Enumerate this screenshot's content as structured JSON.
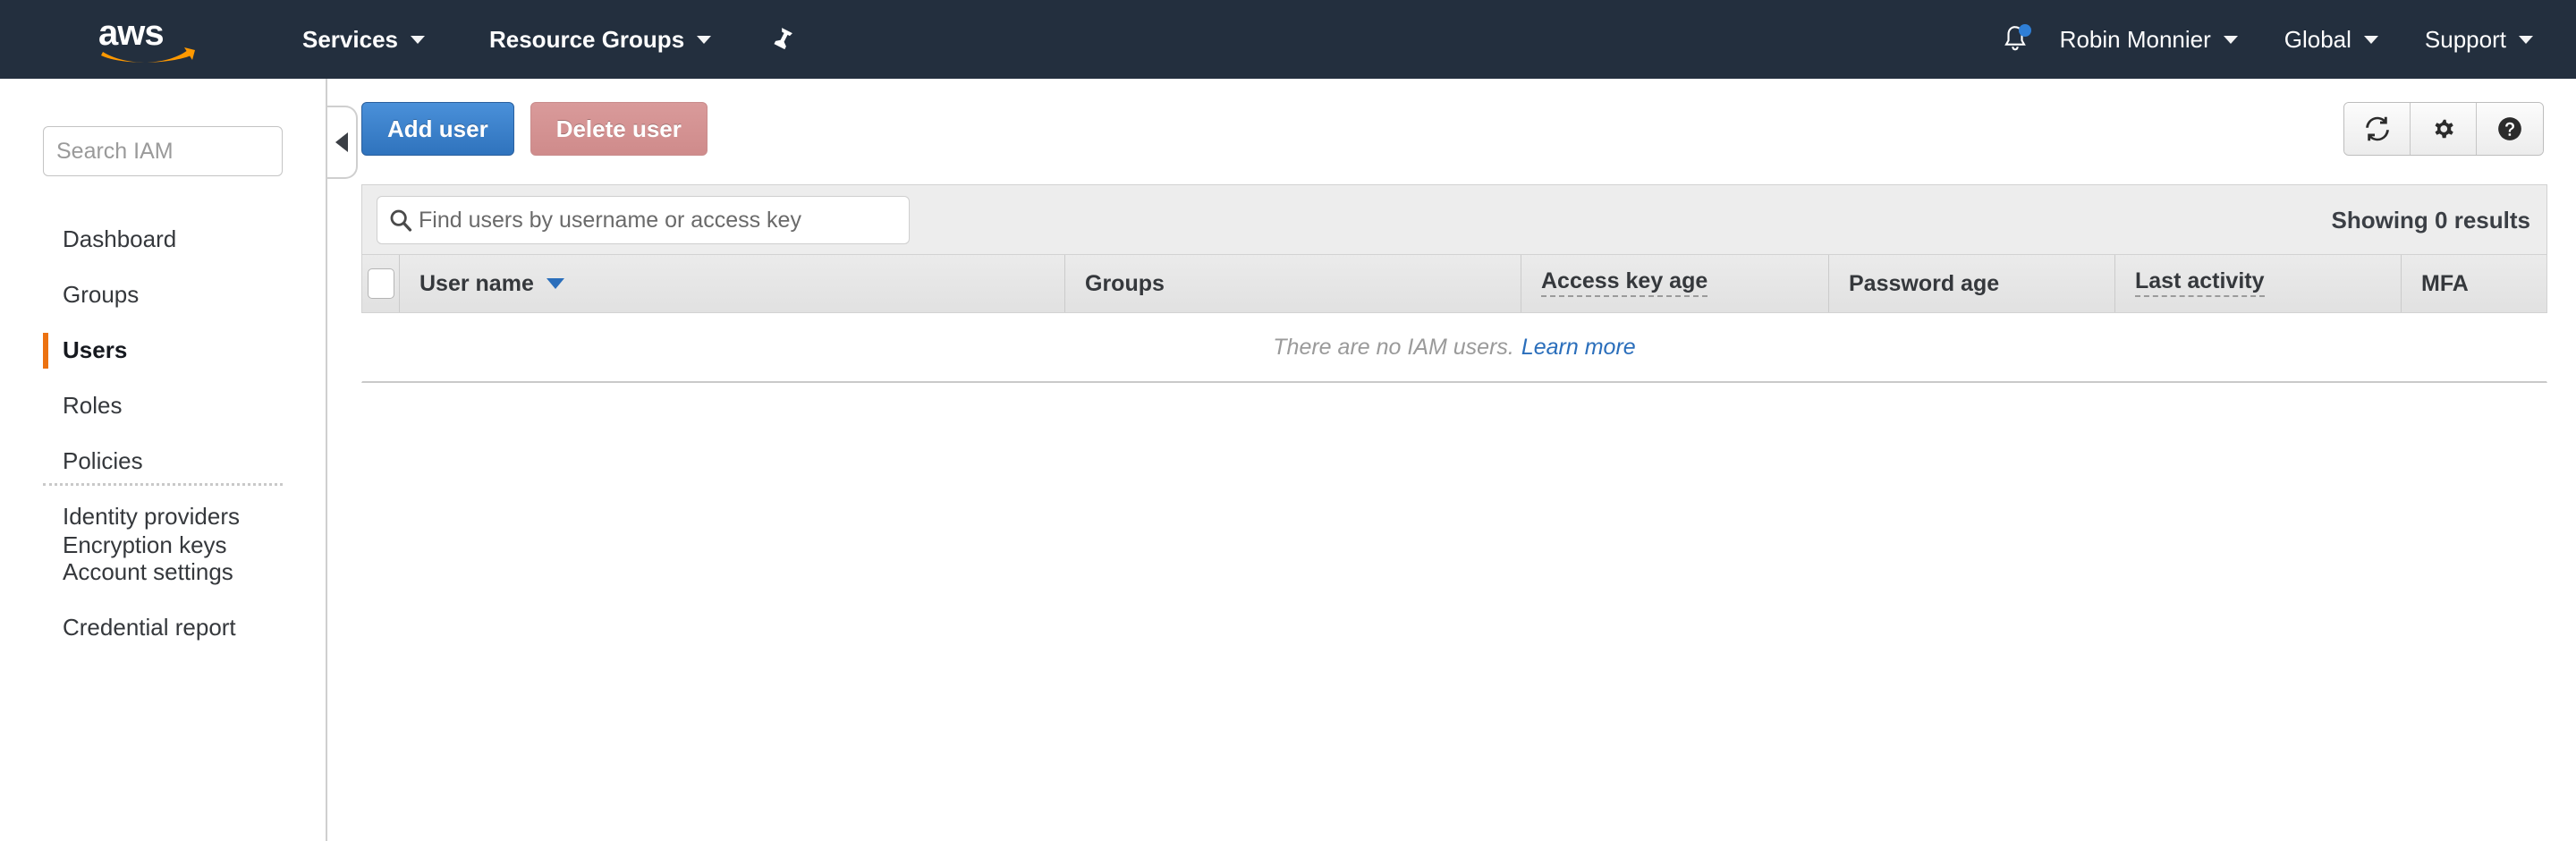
{
  "topnav": {
    "logo_alt": "aws",
    "services": "Services",
    "resource_groups": "Resource Groups",
    "pin_icon": "pushpin-icon",
    "bell_icon": "notifications-bell-icon",
    "user": "Robin Monnier",
    "region": "Global",
    "support": "Support",
    "background": "#232f3e",
    "accent": "#ff9900"
  },
  "sidebar": {
    "search_placeholder": "Search IAM",
    "search_value": "",
    "items": [
      {
        "label": "Dashboard",
        "active": false
      },
      {
        "label": "Groups",
        "active": false
      },
      {
        "label": "Users",
        "active": true
      },
      {
        "label": "Roles",
        "active": false
      },
      {
        "label": "Policies",
        "active": false
      },
      {
        "label": "Identity providers",
        "active": false
      },
      {
        "label": "Account settings",
        "active": false
      },
      {
        "label": "Credential report",
        "active": false
      }
    ],
    "items_after_divider": [
      {
        "label": "Encryption keys",
        "active": false
      }
    ],
    "active_marker_color": "#ec7211",
    "collapse_icon": "chevron-left-icon"
  },
  "toolbar": {
    "add_user_label": "Add user",
    "delete_user_label": "Delete user",
    "add_user_color": "#2f73bd",
    "delete_user_color": "#d99a9a",
    "icons": [
      {
        "name": "refresh-icon",
        "title": "Refresh"
      },
      {
        "name": "gear-icon",
        "title": "Settings"
      },
      {
        "name": "help-icon",
        "title": "Help"
      }
    ]
  },
  "table": {
    "filter_placeholder": "Find users by username or access key",
    "filter_value": "",
    "filter_icon": "search-icon",
    "results_text": "Showing 0 results",
    "select_all_checked": false,
    "sort_column": "User name",
    "sort_direction": "desc",
    "columns": [
      {
        "label": "User name",
        "sorted": true,
        "dashed": false
      },
      {
        "label": "Groups",
        "sorted": false,
        "dashed": false
      },
      {
        "label": "Access key age",
        "sorted": false,
        "dashed": true
      },
      {
        "label": "Password age",
        "sorted": false,
        "dashed": false
      },
      {
        "label": "Last activity",
        "sorted": false,
        "dashed": true
      },
      {
        "label": "MFA",
        "sorted": false,
        "dashed": false
      }
    ],
    "rows": [],
    "empty_message": "There are no IAM users.",
    "empty_link": "Learn more",
    "link_color": "#2a6ebb"
  }
}
